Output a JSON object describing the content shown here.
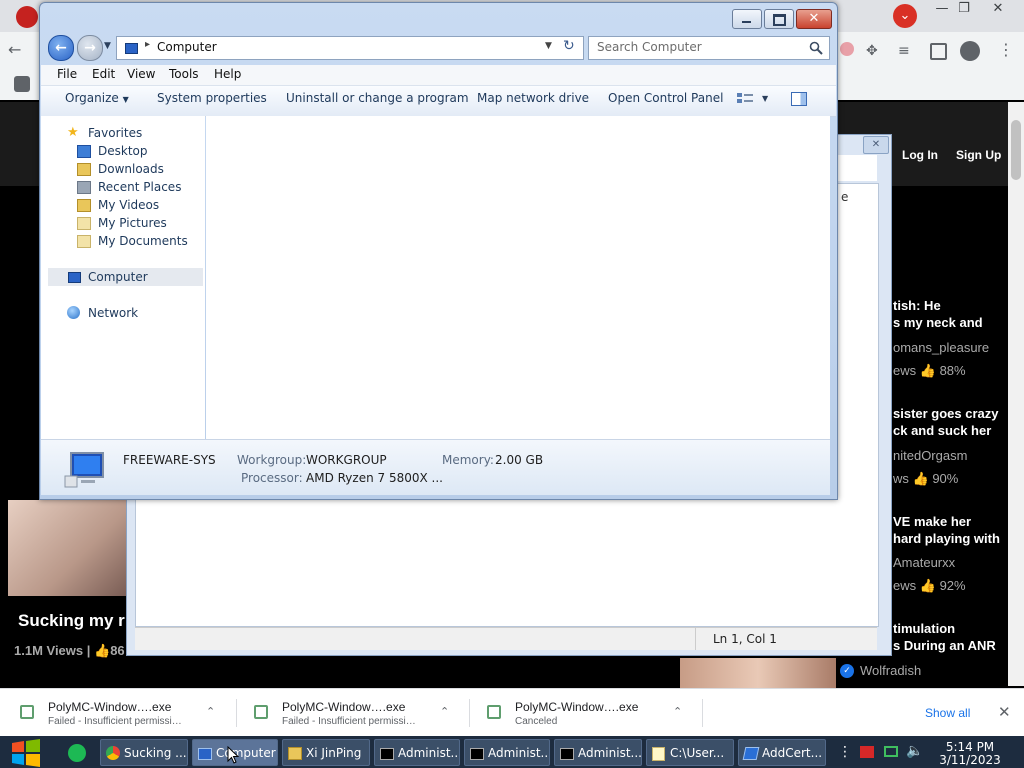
{
  "browser": {
    "header": {
      "login_label": "Log In",
      "signup_label": "Sign Up"
    },
    "sidebar_videos": [
      {
        "title_line1": "tish: He",
        "title_line2": "s my neck and",
        "user": "omans_pleasure",
        "views_suffix": "ews",
        "rating": "88%"
      },
      {
        "title_line1": "sister goes crazy",
        "title_line2": "ck and suck her",
        "user": "nitedOrgasm",
        "views_suffix": "ws",
        "rating": "90%"
      },
      {
        "title_line1": "VE make her",
        "title_line2": "hard playing with",
        "user": "Amateurxx",
        "views_suffix": "ews",
        "rating": "92%"
      },
      {
        "title_line1": "timulation",
        "title_line2": "s During an ANR",
        "user": "Wolfradish"
      }
    ],
    "main_video": {
      "title": "Sucking my r",
      "views": "1.1M Views",
      "rating": "86"
    }
  },
  "notepad": {
    "status_position": "Ln 1, Col 1",
    "sliver_text": "e"
  },
  "explorer": {
    "address": {
      "path": "Computer"
    },
    "search": {
      "placeholder": "Search Computer"
    },
    "menu": [
      "File",
      "Edit",
      "View",
      "Tools",
      "Help"
    ],
    "commands": {
      "organize": "Organize",
      "system_properties": "System properties",
      "uninstall": "Uninstall or change a program",
      "map_drive": "Map network drive",
      "control_panel": "Open Control Panel"
    },
    "nav": {
      "favorites": "Favorites",
      "favorites_items": [
        "Desktop",
        "Downloads",
        "Recent Places",
        "My Videos",
        "My Pictures",
        "My Documents"
      ],
      "computer": "Computer",
      "network": "Network"
    },
    "details": {
      "computer_name": "FREEWARE-SYS",
      "workgroup_label": "Workgroup:",
      "workgroup_value": "WORKGROUP",
      "memory_label": "Memory:",
      "memory_value": "2.00 GB",
      "processor_label": "Processor:",
      "processor_value": "AMD Ryzen 7 5800X ..."
    }
  },
  "downloads": {
    "items": [
      {
        "name": "PolyMC-Window….exe",
        "status": "Failed - Insufficient permissi…"
      },
      {
        "name": "PolyMC-Window….exe",
        "status": "Failed - Insufficient permissi…"
      },
      {
        "name": "PolyMC-Window….exe",
        "status": "Canceled"
      }
    ],
    "show_all_label": "Show all"
  },
  "taskbar": {
    "buttons": [
      {
        "label": "Sucking ..."
      },
      {
        "label": "Computer"
      },
      {
        "label": "Xi JinPing"
      },
      {
        "label": "Administ..."
      },
      {
        "label": "Administ..."
      },
      {
        "label": "Administ..."
      },
      {
        "label": "C:\\User..."
      },
      {
        "label": "AddCert..."
      }
    ],
    "clock": {
      "time": "5:14 PM",
      "date": "3/11/2023"
    }
  },
  "colors": {
    "taskbar": "#1d2c3f",
    "chrome_close_red": "#d93025",
    "explorer_frame": "#b8cde9",
    "show_all_link": "#1a73e8"
  }
}
